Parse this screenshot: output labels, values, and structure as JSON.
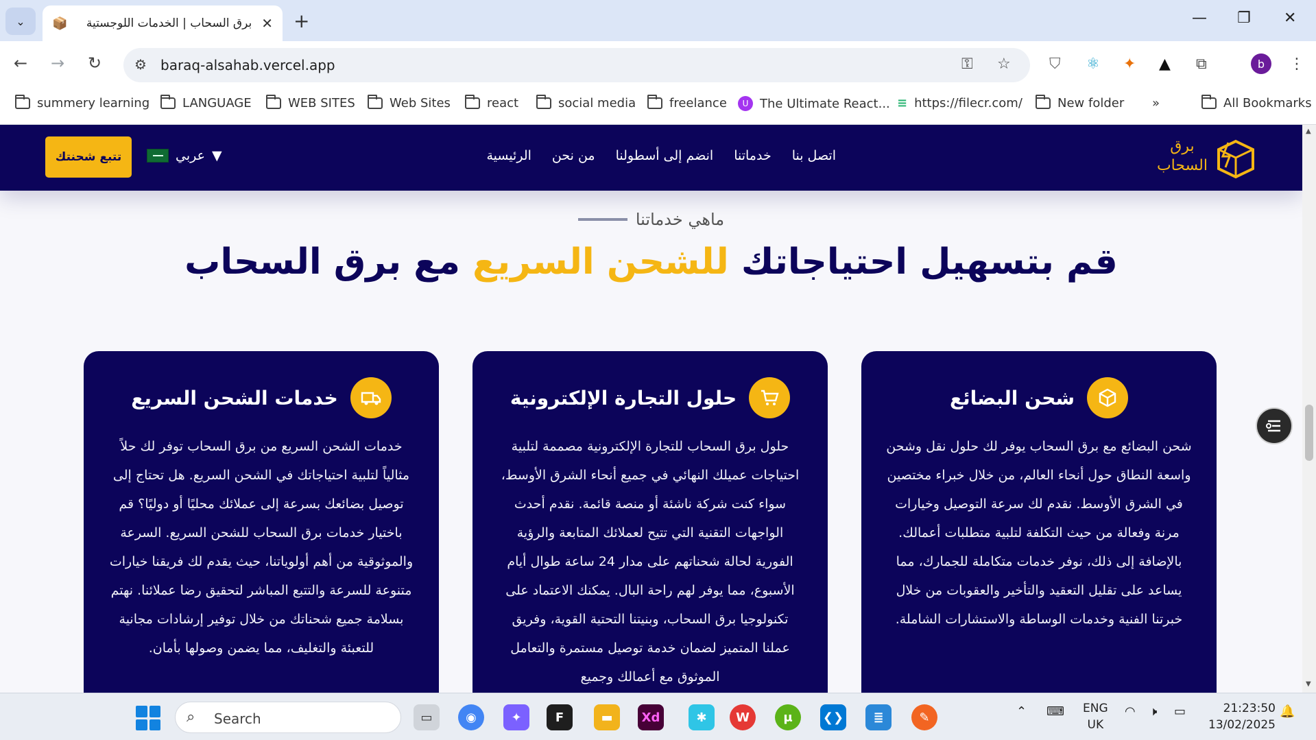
{
  "browser": {
    "tab_title": "برق السحاب | الخدمات اللوجستية",
    "url": "baraq-alsahab.vercel.app",
    "profile_initial": "b",
    "bookmarks": [
      {
        "label": "summery learning",
        "type": "folder"
      },
      {
        "label": "LANGUAGE",
        "type": "folder"
      },
      {
        "label": "WEB SITES",
        "type": "folder"
      },
      {
        "label": "Web Sites",
        "type": "folder"
      },
      {
        "label": "react",
        "type": "folder"
      },
      {
        "label": "social media",
        "type": "folder"
      },
      {
        "label": "freelance",
        "type": "folder"
      },
      {
        "label": "The Ultimate React...",
        "type": "link"
      },
      {
        "label": "https://filecr.com/",
        "type": "link"
      },
      {
        "label": "New folder",
        "type": "folder"
      }
    ],
    "all_bookmarks": "All Bookmarks",
    "overflow": "»"
  },
  "site": {
    "logo_line1": "برق",
    "logo_line2": "السحاب",
    "menu": [
      "الرئيسية",
      "من نحن",
      "انضم إلى أسطولنا",
      "خدماتنا",
      "اتصل بنا"
    ],
    "language": "عربي",
    "language_caret": "▼",
    "track_button": "تتبع شحنتك",
    "eyebrow": "ماهي خدماتنا",
    "headline_part1": "قم بتسهيل احتياجاتك",
    "headline_accent": "للشحن السريع",
    "headline_part2": "مع برق السحاب",
    "cards": [
      {
        "title": "شحن البضائع",
        "icon": "box-icon",
        "text": "شحن البضائع مع برق السحاب يوفر لك حلول نقل وشحن واسعة النطاق حول أنحاء العالم، من خلال خبراء مختصين في الشرق الأوسط. نقدم لك سرعة التوصيل وخيارات مرنة وفعالة من حيث التكلفة لتلبية متطلبات أعمالك. بالإضافة إلى ذلك، نوفر خدمات متكاملة للجمارك، مما يساعد على تقليل التعقيد والتأخير والعقوبات من خلال خبرتنا الفنية وخدمات الوساطة والاستشارات الشاملة."
      },
      {
        "title": "حلول التجارة الإلكترونية",
        "icon": "cart-icon",
        "text": "حلول برق السحاب للتجارة الإلكترونية مصممة لتلبية احتياجات عميلك النهائي في جميع أنحاء الشرق الأوسط، سواء كنت شركة ناشئة أو منصة قائمة. نقدم أحدث الواجهات التقنية التي تتيح لعملائك المتابعة والرؤية الفورية لحالة شحناتهم على مدار 24 ساعة طوال أيام الأسبوع، مما يوفر لهم راحة البال. يمكنك الاعتماد على تكنولوجيا برق السحاب، وبنيتنا التحتية القوية، وفريق عملنا المتميز لضمان خدمة توصيل مستمرة والتعامل الموثوق مع أعمالك وجميع"
      },
      {
        "title": "خدمات الشحن السريع",
        "icon": "truck-icon",
        "text": "خدمات الشحن السريع من برق السحاب توفر لك حلاً مثالياً لتلبية احتياجاتك في الشحن السريع. هل تحتاج إلى توصيل بضائعك بسرعة إلى عملائك محليًا أو دوليًا؟ قم باختيار خدمات برق السحاب للشحن السريع. السرعة والموثوقية من أهم أولوياتنا، حيث يقدم لك فريقنا خيارات متنوعة للسرعة والتتبع المباشر لتحقيق رضا عملائنا. نهتم بسلامة جميع شحناتك من خلال توفير إرشادات مجانية للتعبئة والتغليف، مما يضمن وصولها بأمان."
      }
    ]
  },
  "taskbar": {
    "search_placeholder": "Search",
    "lang_line1": "ENG",
    "lang_line2": "UK",
    "time": "21:23:50",
    "date": "13/02/2025"
  },
  "colors": {
    "navy": "#0c045a",
    "gold": "#f5b614"
  }
}
